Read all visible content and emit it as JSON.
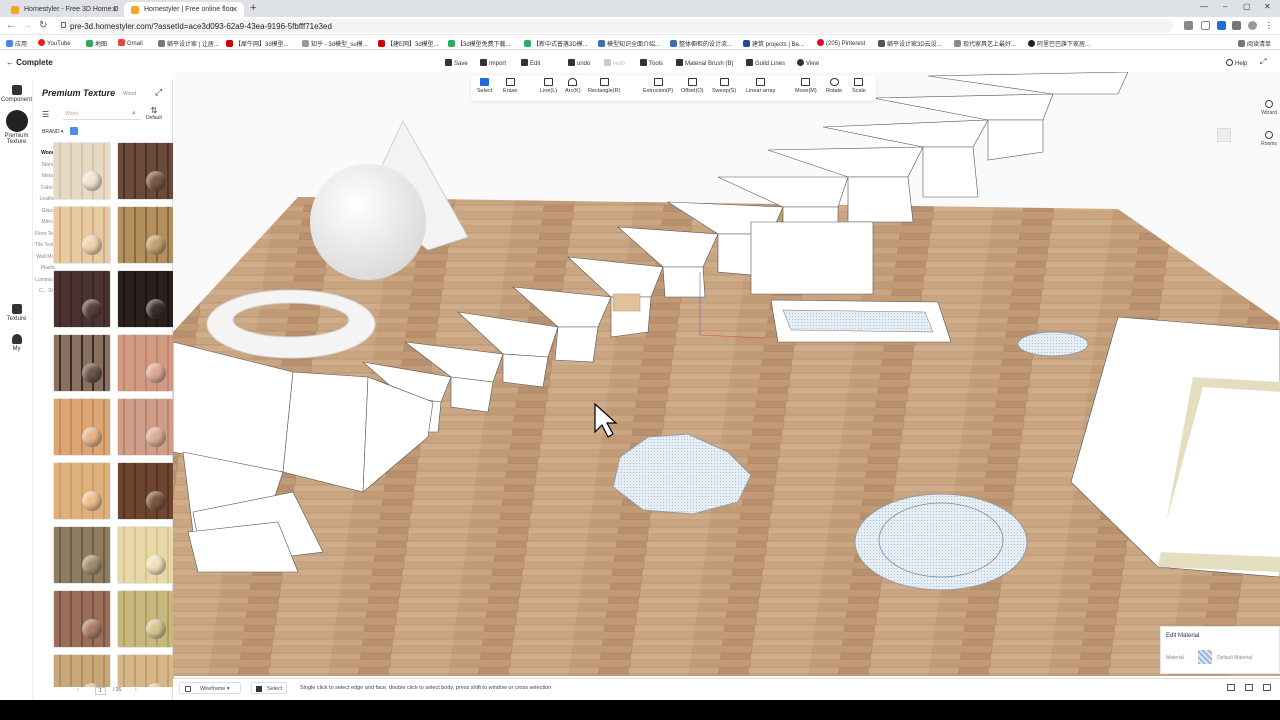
{
  "browser": {
    "tabs": [
      {
        "title": "Homestyler - Free 3D Home D"
      },
      {
        "title": "Homestyler | Free online floo"
      }
    ],
    "url": "pre-3d.homestyler.com/?assetId=ace3d093-62a9-43ea-9196-5fbfff71e3ed",
    "bookmarks": [
      "应用",
      "YouTube",
      "地图",
      "Gmail",
      "躺平设计家 | 让居...",
      "【犀牛网】3d模型...",
      "知乎 - 3d模型_su模...",
      "【建E网】3d模型...",
      "【3d模型免费下载...",
      "【新中式普落3D模...",
      "模型知识全面介绍...",
      "整体橱柜的设计流...",
      "建筑 projects | Be...",
      "(205) Pinterest",
      "躺平设计家3D云设...",
      "现代家具艺上最好...",
      "阿里巴巴旗下家居..."
    ],
    "reading_list": "阅读清单"
  },
  "toolbar": {
    "complete": "Complete",
    "items": [
      "Save",
      "Import",
      "Edit",
      "undo",
      "redo",
      "Tools",
      "Material Brush (B)",
      "Guild Lines",
      "View"
    ],
    "help": "Help"
  },
  "rail": {
    "items": [
      "Component",
      "Premium Texture",
      "Texture",
      "My"
    ]
  },
  "panel": {
    "title": "Premium Texture",
    "subtitle": "Wood",
    "search_placeholder": "Wood",
    "sort_label": "Default",
    "brand_label": "BRAND",
    "categories": [
      "Wood",
      "Stone",
      "Metal",
      "Fabric",
      "Leather",
      "Glass",
      "Mirror",
      "Floor Text...",
      "Tile Texture",
      "Wall Mat...",
      "Plastic",
      "Luminous...",
      "C... Sl..."
    ],
    "selected_category": "Wood",
    "page": "1",
    "total_pages": "/ 26"
  },
  "swatches": [
    {
      "base": "#e6dac4",
      "grain": "#d6c6a8",
      "ball": "#efe4cf"
    },
    {
      "base": "#6b4a3a",
      "grain": "#4b3226",
      "ball": "#7a5745"
    },
    {
      "base": "#e7c9a2",
      "grain": "#d4ad80",
      "ball": "#ecd3b0"
    },
    {
      "base": "#b48f5e",
      "grain": "#8c6a42",
      "ball": "#c39e6c"
    },
    {
      "base": "#4a3330",
      "grain": "#3a2624",
      "ball": "#5a403c"
    },
    {
      "base": "#2a211f",
      "grain": "#1a1413",
      "ball": "#3a2e2b"
    },
    {
      "base": "#8a7060",
      "grain": "#3b2e26",
      "ball": "#6a5446"
    },
    {
      "base": "#d39a82",
      "grain": "#c08670",
      "ball": "#dba896"
    },
    {
      "base": "#dba574",
      "grain": "#c48c5c",
      "ball": "#e4b488"
    },
    {
      "base": "#cf9d88",
      "grain": "#b9856f",
      "ball": "#d9ac99"
    },
    {
      "base": "#e0b07a",
      "grain": "#caa06a",
      "ball": "#e9c08e"
    },
    {
      "base": "#6e4630",
      "grain": "#573520",
      "ball": "#7c5440"
    },
    {
      "base": "#8e7c60",
      "grain": "#6e5e44",
      "ball": "#a08e72"
    },
    {
      "base": "#e8d8a8",
      "grain": "#d8c68e",
      "ball": "#efe2ba"
    },
    {
      "base": "#9a6e58",
      "grain": "#7a5442",
      "ball": "#a87e68"
    },
    {
      "base": "#c8b87e",
      "grain": "#b0a064",
      "ball": "#d4c690"
    },
    {
      "base": "#c8a878",
      "grain": "#b09060",
      "ball": "#d4b88c"
    },
    {
      "base": "#d6b888",
      "grain": "#c0a070",
      "ball": "#e0c69a"
    }
  ],
  "ribbon": {
    "tools": [
      "Select",
      "Erase",
      "Line(L)",
      "Arc(K)",
      "Rectangle(R)",
      "Extrusion(P)",
      "Offset(O)",
      "Sweep(S)",
      "Linear array",
      "Move(M)",
      "Rotate",
      "Scale"
    ],
    "selected": "Select"
  },
  "side_tools": [
    "Wizard",
    "Rooms"
  ],
  "edit_material": {
    "title": "Edit Material",
    "label": "Material",
    "value": "Default Material"
  },
  "statusbar": {
    "view_mode": "Wireframe",
    "tool": "Select",
    "hint": "Single click to select edge and face, double click to select body, press shift to window or cross selection"
  },
  "colors": {
    "floor": "#c9a582",
    "accent": "#1e6fd9",
    "floor_tile": "#a8c4dc"
  }
}
